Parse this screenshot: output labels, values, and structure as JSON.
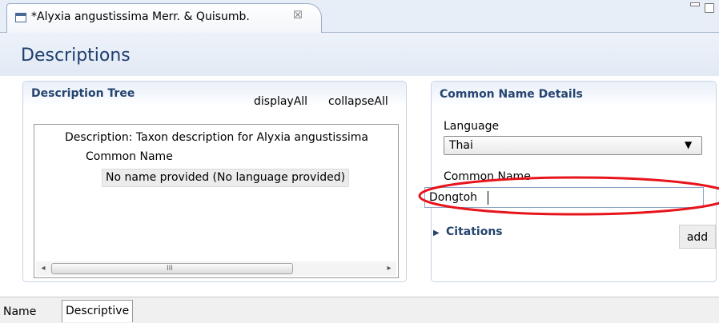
{
  "editor": {
    "tab_title": "*Alyxia angustissima Merr. & Quisumb.",
    "close_glyph": "☒",
    "icons": [
      "document-icon",
      "close-icon",
      "minimize-icon",
      "maximize-icon"
    ]
  },
  "section": {
    "title": "Descriptions"
  },
  "tree_panel": {
    "title": "Description Tree",
    "display_all": "displayAll",
    "collapse_all": "collapseAll",
    "nodes": [
      "Description: Taxon description for Alyxia angustissima",
      "Common Name",
      "No name provided (No language provided)"
    ],
    "scroll": {
      "left_glyph": "◂",
      "right_glyph": "▸",
      "grip": "III"
    }
  },
  "details_panel": {
    "title": "Common Name Details",
    "language_label": "Language",
    "language_value": "Thai",
    "select_arrow": "▼",
    "common_name_label": "Common Name",
    "common_name_value": "Dongtoh",
    "citations_arrow": "▶",
    "citations_label": "Citations",
    "add_label": "add"
  },
  "bottom_tabs": [
    "Name",
    "Descriptive"
  ],
  "colors": {
    "accent": "#25446f",
    "title": "#1f3f6f",
    "annotation": "#e8141c"
  }
}
